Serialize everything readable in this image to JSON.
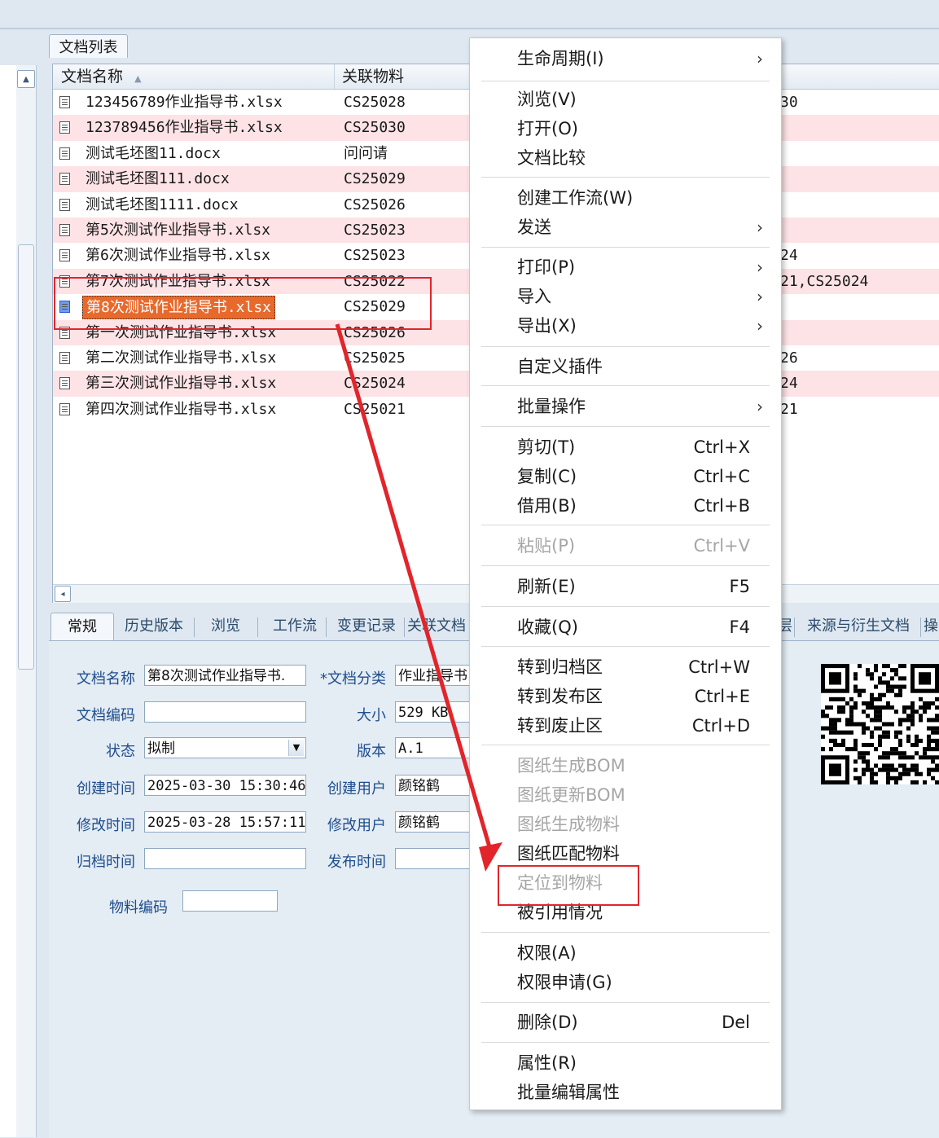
{
  "tab_title": "文档列表",
  "grid": {
    "headers": {
      "name": "文档名称",
      "name_sort": "▲",
      "material": "关联物料"
    },
    "rows": [
      {
        "name": "123456789作业指导书.xlsx",
        "material": "CS25028",
        "extra": "30"
      },
      {
        "name": "123789456作业指导书.xlsx",
        "material": "CS25030",
        "extra": ""
      },
      {
        "name": "测试毛坯图11.docx",
        "material": "问问请",
        "extra": ""
      },
      {
        "name": "测试毛坯图111.docx",
        "material": "CS25029",
        "extra": ""
      },
      {
        "name": "测试毛坯图1111.docx",
        "material": "CS25026",
        "extra": ""
      },
      {
        "name": "第5次测试作业指导书.xlsx",
        "material": "CS25023",
        "extra": ""
      },
      {
        "name": "第6次测试作业指导书.xlsx",
        "material": "CS25023",
        "extra": "24"
      },
      {
        "name": "第7次测试作业指导书.xlsx",
        "material": "CS25022",
        "extra": "21,CS25024"
      },
      {
        "name": "第8次测试作业指导书.xlsx",
        "material": "CS25029",
        "extra": ""
      },
      {
        "name": "第一次测试作业指导书.xlsx",
        "material": "CS25026",
        "extra": ""
      },
      {
        "name": "第二次测试作业指导书.xlsx",
        "material": "CS25025",
        "extra": "26"
      },
      {
        "name": "第三次测试作业指导书.xlsx",
        "material": "CS25024",
        "extra": "24"
      },
      {
        "name": "第四次测试作业指导书.xlsx",
        "material": "CS25021",
        "extra": "21"
      }
    ]
  },
  "bottom_tabs": [
    "常规",
    "历史版本",
    "浏览",
    "工作流",
    "变更记录",
    "关联文档",
    "层",
    "来源与衍生文档",
    "操"
  ],
  "form": {
    "doc_name_label": "文档名称",
    "doc_name_value": "第8次测试作业指导书.",
    "doc_class_label": "*文档分类",
    "doc_class_value": "作业指导书",
    "doc_code_label": "文档编码",
    "doc_code_value": "",
    "size_label": "大小",
    "size_value": "529 KB",
    "status_label": "状态",
    "status_value": "拟制",
    "version_label": "版本",
    "version_value": "A.1",
    "created_label": "创建时间",
    "created_value": "2025-03-30 15:30:46",
    "creator_label": "创建用户",
    "creator_value": "颜铭鹤",
    "modified_label": "修改时间",
    "modified_value": "2025-03-28 15:57:11",
    "modifier_label": "修改用户",
    "modifier_value": "颜铭鹤",
    "archived_label": "归档时间",
    "archived_value": "",
    "published_label": "发布时间",
    "published_value": "",
    "material_code_label": "物料编码",
    "material_code_value": ""
  },
  "menu": [
    {
      "label": "生命周期(I)",
      "key": "",
      "submenu": true,
      "disabled": false
    },
    {
      "label": "浏览(V)",
      "key": "",
      "submenu": false,
      "disabled": false
    },
    {
      "label": "打开(O)",
      "key": "",
      "submenu": false,
      "disabled": false
    },
    {
      "label": "文档比较",
      "key": "",
      "submenu": false,
      "disabled": false
    },
    {
      "label": "创建工作流(W)",
      "key": "",
      "submenu": false,
      "disabled": false
    },
    {
      "label": "发送",
      "key": "",
      "submenu": true,
      "disabled": false
    },
    {
      "label": "打印(P)",
      "key": "",
      "submenu": true,
      "disabled": false
    },
    {
      "label": "导入",
      "key": "",
      "submenu": true,
      "disabled": false
    },
    {
      "label": "导出(X)",
      "key": "",
      "submenu": true,
      "disabled": false
    },
    {
      "label": "自定义插件",
      "key": "",
      "submenu": false,
      "disabled": false
    },
    {
      "label": "批量操作",
      "key": "",
      "submenu": true,
      "disabled": false
    },
    {
      "label": "剪切(T)",
      "key": "Ctrl+X",
      "submenu": false,
      "disabled": false
    },
    {
      "label": "复制(C)",
      "key": "Ctrl+C",
      "submenu": false,
      "disabled": false
    },
    {
      "label": "借用(B)",
      "key": "Ctrl+B",
      "submenu": false,
      "disabled": false
    },
    {
      "label": "粘贴(P)",
      "key": "Ctrl+V",
      "submenu": false,
      "disabled": true
    },
    {
      "label": "刷新(E)",
      "key": "F5",
      "submenu": false,
      "disabled": false
    },
    {
      "label": "收藏(Q)",
      "key": "F4",
      "submenu": false,
      "disabled": false
    },
    {
      "label": "转到归档区",
      "key": "Ctrl+W",
      "submenu": false,
      "disabled": false
    },
    {
      "label": "转到发布区",
      "key": "Ctrl+E",
      "submenu": false,
      "disabled": false
    },
    {
      "label": "转到废止区",
      "key": "Ctrl+D",
      "submenu": false,
      "disabled": false
    },
    {
      "label": "图纸生成BOM",
      "key": "",
      "submenu": false,
      "disabled": true
    },
    {
      "label": "图纸更新BOM",
      "key": "",
      "submenu": false,
      "disabled": true
    },
    {
      "label": "图纸生成物料",
      "key": "",
      "submenu": false,
      "disabled": true
    },
    {
      "label": "图纸匹配物料",
      "key": "",
      "submenu": false,
      "disabled": false
    },
    {
      "label": "定位到物料",
      "key": "",
      "submenu": false,
      "disabled": true
    },
    {
      "label": "被引用情况",
      "key": "",
      "submenu": false,
      "disabled": false
    },
    {
      "label": "权限(A)",
      "key": "",
      "submenu": false,
      "disabled": false
    },
    {
      "label": "权限申请(G)",
      "key": "",
      "submenu": false,
      "disabled": false
    },
    {
      "label": "删除(D)",
      "key": "Del",
      "submenu": false,
      "disabled": false
    },
    {
      "label": "属性(R)",
      "key": "",
      "submenu": false,
      "disabled": false
    },
    {
      "label": "批量编辑属性",
      "key": "",
      "submenu": false,
      "disabled": false
    }
  ],
  "submenu_arrow": "›",
  "colors": {
    "selection": "#e8692c",
    "pink_row": "#fde3e6",
    "annotation": "#e1252b"
  }
}
